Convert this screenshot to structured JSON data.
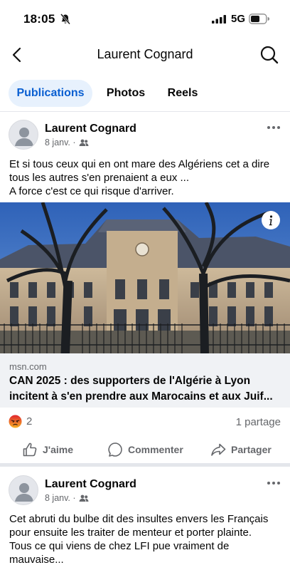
{
  "status_bar": {
    "time": "18:05",
    "network": "5G"
  },
  "nav": {
    "title": "Laurent Cognard"
  },
  "tabs": [
    {
      "label": "Publications",
      "active": true
    },
    {
      "label": "Photos",
      "active": false
    },
    {
      "label": "Reels",
      "active": false
    }
  ],
  "posts": [
    {
      "author": "Laurent Cognard",
      "date": "8 janv. ·",
      "text": "Et si tous ceux qui en ont mare des Algériens cet a dire tous les autres s'en prenaient a eux ...\nA force c'est ce qui risque d'arriver.",
      "link": {
        "domain": "msn.com",
        "title": "CAN 2025 : des supporters de l'Algérie à Lyon incitent à s'en prendre aux Marocains et aux Juif..."
      },
      "reactions_count": "2",
      "shares": "1 partage",
      "actions": {
        "like": "J'aime",
        "comment": "Commenter",
        "share": "Partager"
      }
    },
    {
      "author": "Laurent Cognard",
      "date": "8 janv. ·",
      "text": "Cet abruti du bulbe dit des insultes envers les Français pour ensuite les traiter de menteur et porter plainte.\nTous ce qui viens de chez LFI pue vraiment de mauvaise..."
    }
  ],
  "colors": {
    "accent": "#0a5fd1",
    "accent_bg": "#e7f1fd",
    "secondary_text": "#65676b",
    "angry": "#f0592d"
  },
  "icons": [
    "bell-off-icon",
    "signal-icon",
    "battery-icon",
    "back-icon",
    "search-icon",
    "more-icon",
    "friends-icon",
    "info-icon",
    "angry-reaction-icon",
    "like-icon",
    "comment-icon",
    "share-icon"
  ]
}
